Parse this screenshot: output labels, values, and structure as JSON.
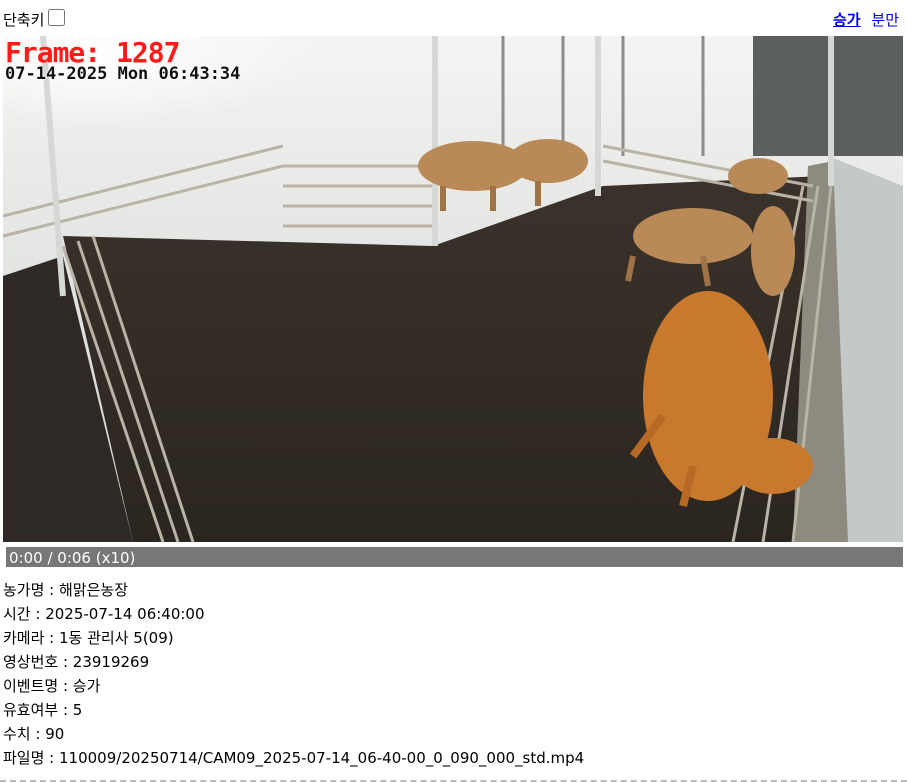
{
  "shortcut": {
    "label": "단축키",
    "checked": false
  },
  "tabs": [
    {
      "label": "승가",
      "active": true
    },
    {
      "label": "분만",
      "active": false
    }
  ],
  "video": {
    "frame_text": "Frame: 1287",
    "timestamp_text": "07-14-2025 Mon 06:43:34",
    "progress_text": "0:00 / 0:06 (x10)",
    "progress_fraction": 0.0
  },
  "info": [
    {
      "label": "농가명",
      "value": "해맑은농장"
    },
    {
      "label": "시간",
      "value": "2025-07-14 06:40:00"
    },
    {
      "label": "카메라",
      "value": "1동 관리사 5(09)"
    },
    {
      "label": "영상번호",
      "value": "23919269"
    },
    {
      "label": "이벤트명",
      "value": "승가"
    },
    {
      "label": "유효여부",
      "value": "5"
    },
    {
      "label": "수치",
      "value": "90"
    },
    {
      "label": "파일명",
      "value": "110009/20250714/CAM09_2025-07-14_06-40-00_0_090_000_std.mp4"
    }
  ],
  "colors": {
    "link": "#0000ee",
    "progress_bg": "#777777",
    "frame_overlay": "#ff1a1a"
  }
}
